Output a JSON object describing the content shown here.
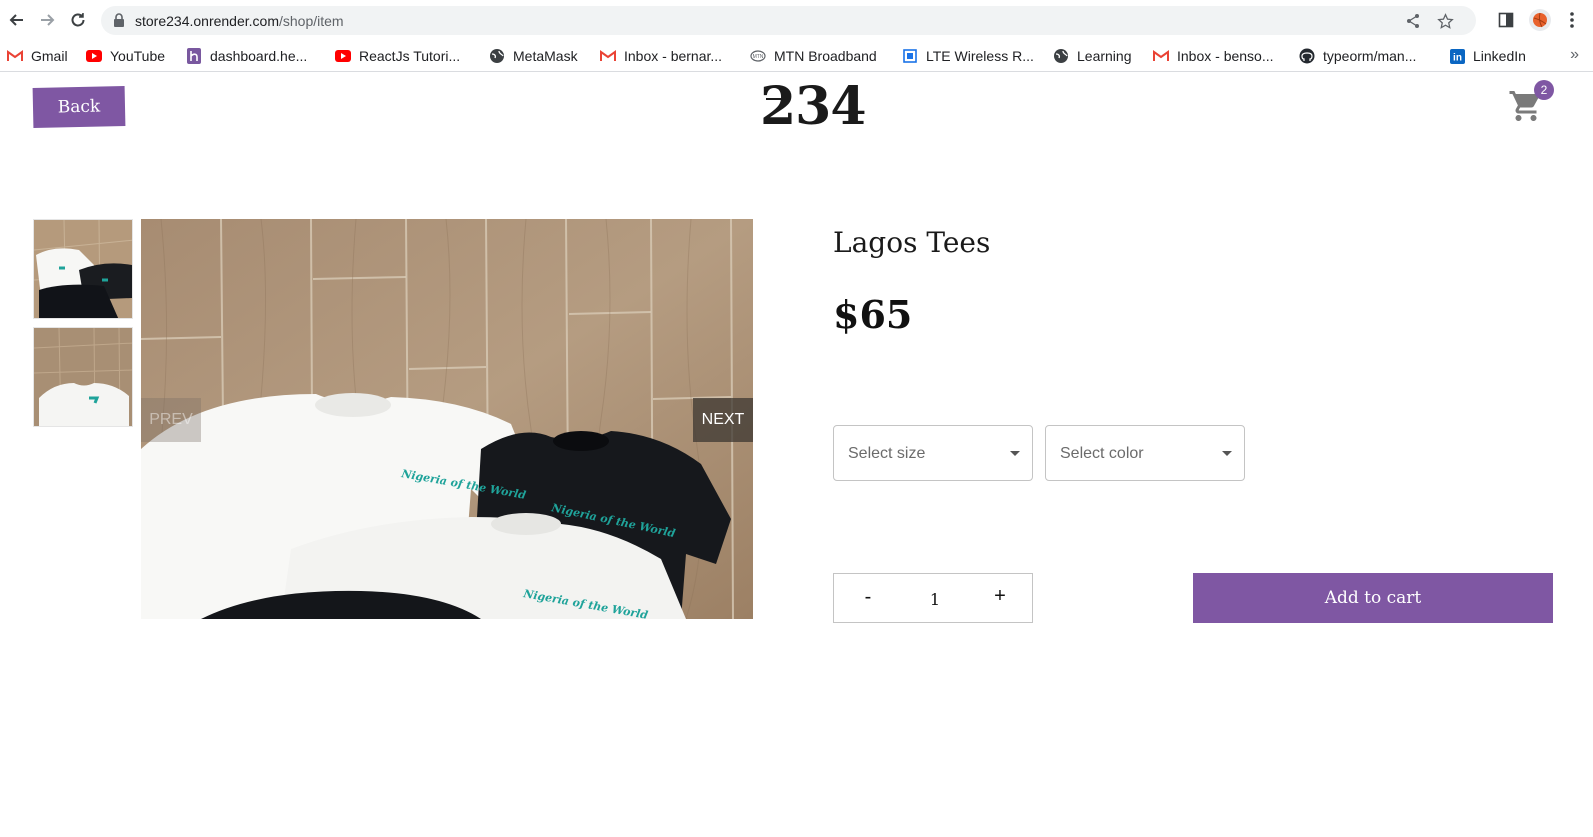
{
  "browser": {
    "url_host": "store234.onrender.com",
    "url_path": "/shop/item",
    "bookmarks": [
      {
        "label": "Gmail",
        "icon": "gmail-icon"
      },
      {
        "label": "YouTube",
        "icon": "youtube-icon"
      },
      {
        "label": "dashboard.he...",
        "icon": "heroku-icon"
      },
      {
        "label": "ReactJs Tutori...",
        "icon": "youtube-icon"
      },
      {
        "label": "MetaMask",
        "icon": "globe-icon"
      },
      {
        "label": "Inbox - bernar...",
        "icon": "gmail-icon"
      },
      {
        "label": "MTN Broadband",
        "icon": "mtn-icon"
      },
      {
        "label": "LTE Wireless R...",
        "icon": "square-icon"
      },
      {
        "label": "Learning",
        "icon": "globe-icon"
      },
      {
        "label": "Inbox - benso...",
        "icon": "gmail-icon"
      },
      {
        "label": "typeorm/man...",
        "icon": "github-icon"
      },
      {
        "label": "LinkedIn",
        "icon": "linkedin-icon"
      }
    ],
    "more_label": "»"
  },
  "header": {
    "back_label": "Back",
    "logo": "234",
    "cart_count": "2"
  },
  "gallery": {
    "prev_label": "PREV",
    "next_label": "NEXT",
    "shirt_text": "Nigeria of the World"
  },
  "product": {
    "title": "Lagos Tees",
    "price": "$65",
    "size_placeholder": "Select size",
    "color_placeholder": "Select color",
    "quantity": "1",
    "minus_label": "-",
    "plus_label": "+",
    "add_to_cart_label": "Add to cart"
  },
  "colors": {
    "accent": "#7f57a3"
  }
}
